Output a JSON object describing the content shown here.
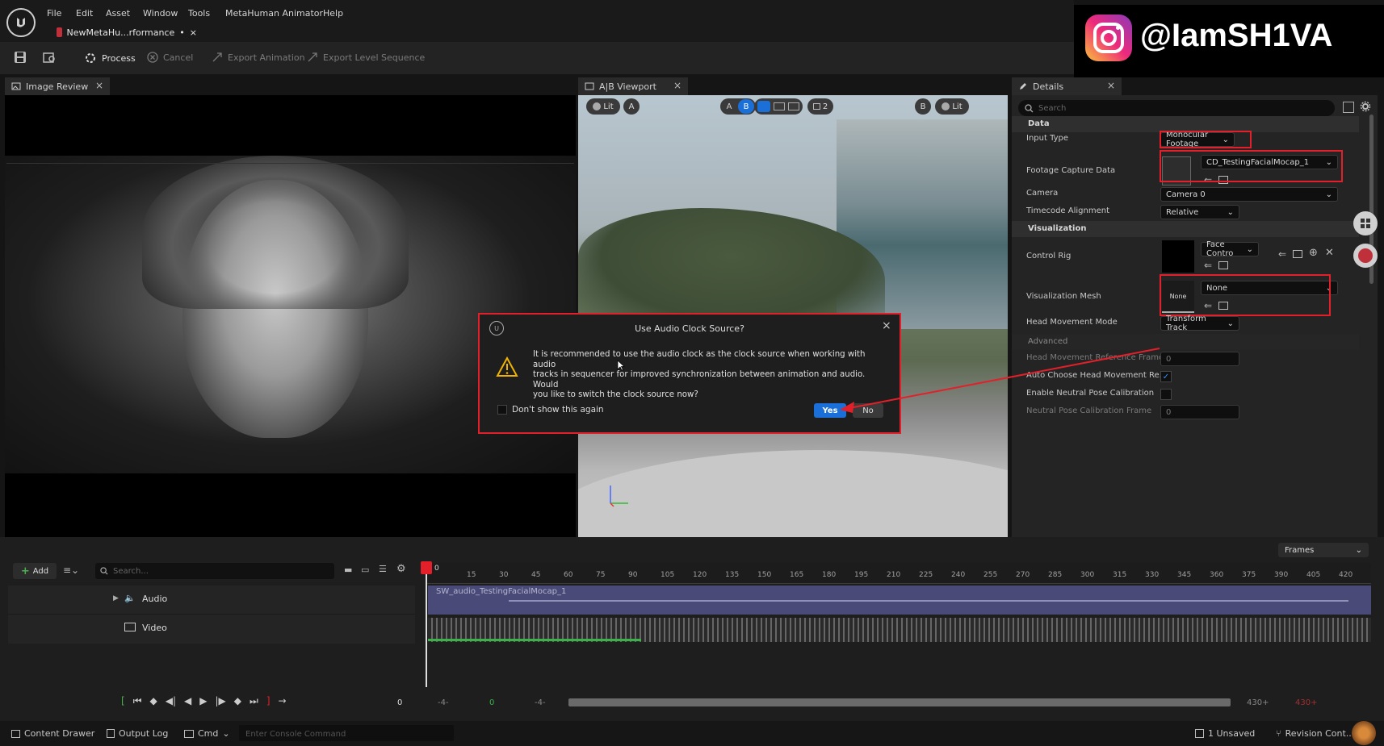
{
  "menu": [
    "File",
    "Edit",
    "Asset",
    "Window",
    "Tools",
    "MetaHuman Animator",
    "Help"
  ],
  "doc_tab": {
    "title": "NewMetaHu...rformance",
    "modified": "•",
    "close": "×"
  },
  "toolbar": {
    "process": "Process",
    "cancel": "Cancel",
    "export_animation": "Export Animation",
    "export_level_sequence": "Export Level Sequence"
  },
  "panels": {
    "image_review": "Image Review",
    "ab_viewport": "A|B Viewport",
    "details": "Details",
    "close": "×"
  },
  "viewport_controls": {
    "lit": "Lit",
    "a": "A",
    "b": "B",
    "b_right": "B",
    "lit_right": "Lit",
    "count": "2"
  },
  "watermark": {
    "handle": "@IamSH1VA"
  },
  "details": {
    "search_placeholder": "Search",
    "sections": {
      "data": "Data",
      "visualization": "Visualization",
      "advanced": "Advanced"
    },
    "input_type": {
      "label": "Input Type",
      "value": "Monocular Footage"
    },
    "footage_capture": {
      "label": "Footage Capture Data",
      "value": "CD_TestingFacialMocap_1"
    },
    "camera": {
      "label": "Camera",
      "value": "Camera 0"
    },
    "timecode": {
      "label": "Timecode Alignment",
      "value": "Relative"
    },
    "control_rig": {
      "label": "Control Rig",
      "value": "Face Contro"
    },
    "vis_mesh": {
      "label": "Visualization Mesh",
      "value": "None",
      "thumb": "None"
    },
    "head_mode": {
      "label": "Head Movement Mode",
      "value": "Transform Track"
    },
    "head_ref": {
      "label": "Head Movement Reference Frame",
      "value": "0"
    },
    "auto_head": {
      "label": "Auto Choose Head Movement Re...",
      "checked": true
    },
    "neutral_pose": {
      "label": "Enable Neutral Pose Calibration",
      "checked": false
    },
    "neutral_frame": {
      "label": "Neutral Pose Calibration Frame",
      "value": "0"
    }
  },
  "dialog": {
    "title": "Use Audio Clock Source?",
    "line1": "It is recommended to use the audio clock as the clock source when working with audio",
    "line2": "tracks in sequencer for improved synchronization between animation and audio. Would",
    "line3": "you like to switch the clock source now?",
    "checkbox": "Don't show this again",
    "yes": "Yes",
    "no": "No",
    "close": "×"
  },
  "sequencer": {
    "add": "Add",
    "search_placeholder": "Search...",
    "frames": "Frames",
    "tracks": [
      {
        "name": "Audio"
      },
      {
        "name": "Video"
      }
    ],
    "clip": "SW_audio_TestingFacialMocap_1",
    "playhead": "0",
    "ruler": [
      "15",
      "30",
      "45",
      "60",
      "75",
      "90",
      "105",
      "120",
      "135",
      "150",
      "165",
      "180",
      "195",
      "210",
      "225",
      "240",
      "255",
      "270",
      "285",
      "300",
      "315",
      "330",
      "345",
      "360",
      "375",
      "390",
      "405",
      "420"
    ],
    "frame_current": "0",
    "range_start": "-4-",
    "range_mid": "0",
    "range_mid2": "-4-",
    "range_end": "430+",
    "range_end2": "430+"
  },
  "statusbar": {
    "content_drawer": "Content Drawer",
    "output_log": "Output Log",
    "cmd": "Cmd",
    "console_placeholder": "Enter Console Command",
    "unsaved": "1 Unsaved",
    "revision": "Revision Cont..."
  },
  "colors": {
    "accent": "#1a6fd8",
    "highlight": "#e3202a",
    "timeline_clip": "#4a4a78"
  }
}
